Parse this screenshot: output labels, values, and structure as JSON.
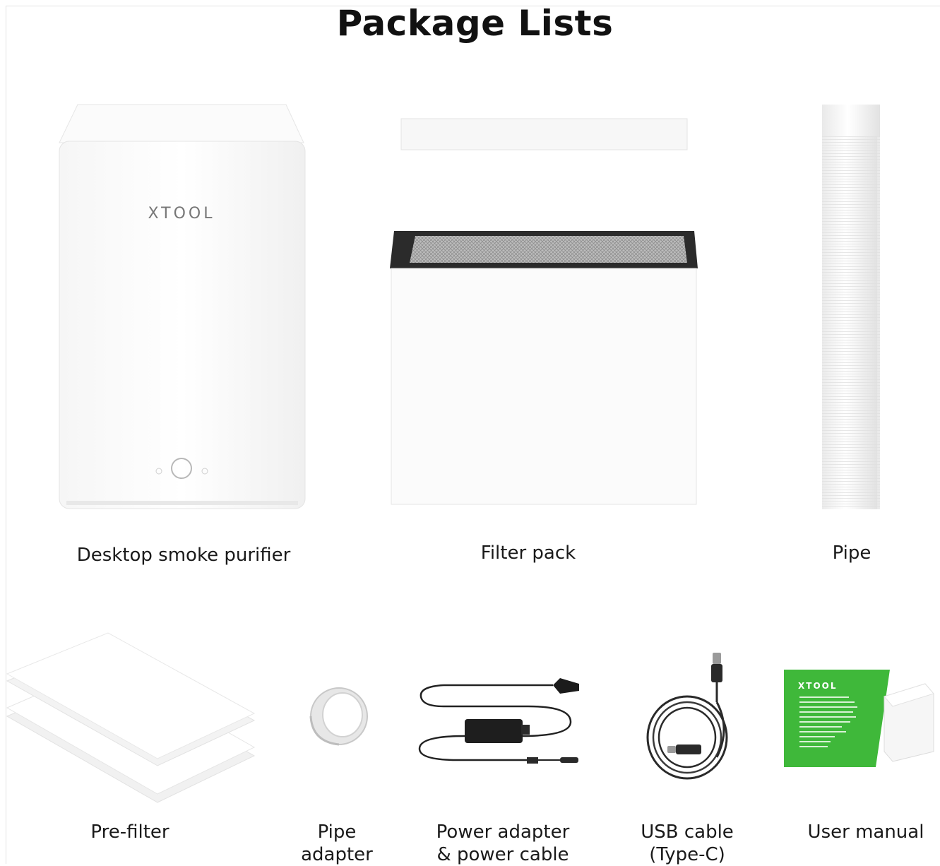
{
  "page": {
    "title": "Package Lists"
  },
  "brand": {
    "logo_text": "XTOOL"
  },
  "items": [
    {
      "label": "Desktop smoke purifier",
      "icon": "purifier-icon"
    },
    {
      "label": "Filter pack",
      "icon": "filter-pack-icon"
    },
    {
      "label": "Pipe",
      "icon": "pipe-icon"
    },
    {
      "label": "Pre-filter",
      "icon": "pre-filter-icon"
    },
    {
      "label": "Pipe\nadapter",
      "line1": "Pipe",
      "line2": "adapter",
      "icon": "pipe-adapter-icon"
    },
    {
      "label": "Power adapter\n& power cable",
      "line1": "Power adapter",
      "line2": "& power cable",
      "icon": "power-adapter-icon"
    },
    {
      "label": "USB cable\n(Type-C)",
      "line1": "USB cable",
      "line2": "(Type-C)",
      "icon": "usb-cable-icon"
    },
    {
      "label": "User manual",
      "icon": "user-manual-icon"
    }
  ],
  "colors": {
    "manual_green": "#3fb83a",
    "text": "#1a1a1a",
    "background": "#ffffff"
  }
}
